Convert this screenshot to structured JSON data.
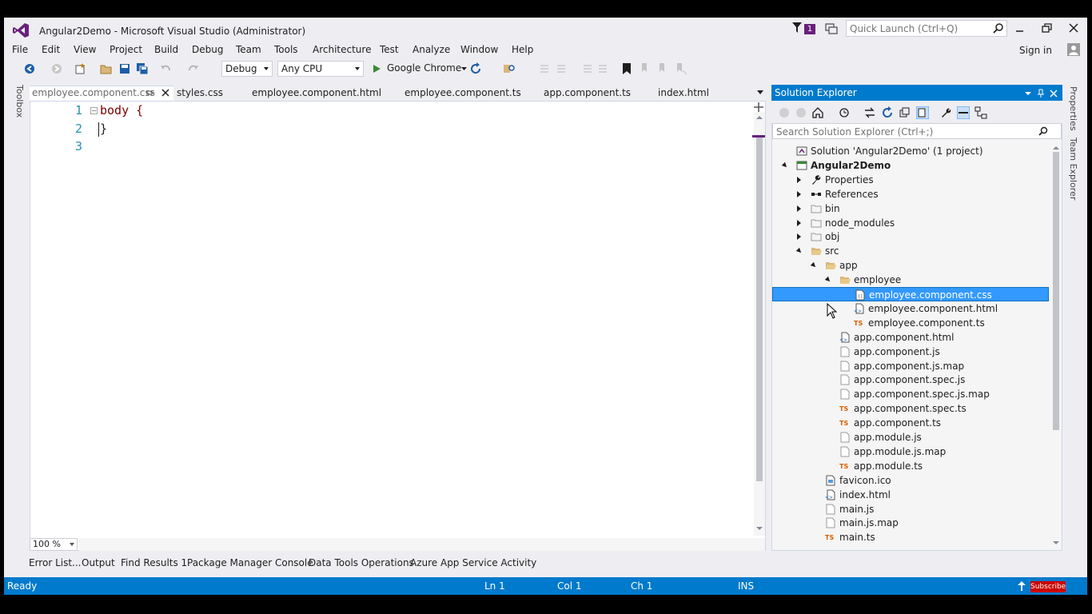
{
  "window": {
    "title": "Angular2Demo - Microsoft Visual Studio (Administrator)",
    "notification_count": "1",
    "quick_launch_placeholder": "Quick Launch (Ctrl+Q)",
    "sign_in": "Sign in"
  },
  "menu": [
    "File",
    "Edit",
    "View",
    "Project",
    "Build",
    "Debug",
    "Team",
    "Tools",
    "Architecture",
    "Test",
    "Analyze",
    "Window",
    "Help"
  ],
  "toolbar": {
    "configuration": "Debug",
    "platform": "Any CPU",
    "run_target": "Google Chrome"
  },
  "side_strips": {
    "left": "Toolbox",
    "right": [
      "Properties",
      "Team Explorer"
    ]
  },
  "document_tabs": [
    {
      "label": "employee.component.css",
      "active": true
    },
    {
      "label": "styles.css",
      "active": false
    },
    {
      "label": "employee.component.html",
      "active": false
    },
    {
      "label": "employee.component.ts",
      "active": false
    },
    {
      "label": "app.component.ts",
      "active": false
    },
    {
      "label": "index.html",
      "active": false
    }
  ],
  "editor": {
    "lines": [
      {
        "num": "1",
        "code": "body {"
      },
      {
        "num": "2",
        "code": "}"
      },
      {
        "num": "3",
        "code": ""
      }
    ],
    "zoom": "100 %"
  },
  "bottom_tabs": [
    "Error List...",
    "Output",
    "Find Results 1",
    "Package Manager Console",
    "Data Tools Operations",
    "Azure App Service Activity"
  ],
  "status": {
    "state": "Ready",
    "line": "Ln 1",
    "col": "Col 1",
    "ch": "Ch 1",
    "mode": "INS",
    "subscribe": "Subscribe"
  },
  "solution_explorer": {
    "title": "Solution Explorer",
    "search_placeholder": "Search Solution Explorer (Ctrl+;)",
    "items": [
      {
        "label": "Solution 'Angular2Demo' (1 project)",
        "level": 0,
        "expander": "none",
        "icon": "solution-icon"
      },
      {
        "label": "Angular2Demo",
        "level": 0,
        "expander": "expanded",
        "icon": "web-project-icon",
        "bold": true
      },
      {
        "label": "Properties",
        "level": 1,
        "expander": "collapsed",
        "icon": "wrench-icon"
      },
      {
        "label": "References",
        "level": 1,
        "expander": "collapsed",
        "icon": "references-icon"
      },
      {
        "label": "bin",
        "level": 1,
        "expander": "collapsed",
        "icon": "folder-outline-icon"
      },
      {
        "label": "node_modules",
        "level": 1,
        "expander": "collapsed",
        "icon": "folder-outline-icon"
      },
      {
        "label": "obj",
        "level": 1,
        "expander": "collapsed",
        "icon": "folder-outline-icon"
      },
      {
        "label": "src",
        "level": 1,
        "expander": "expanded",
        "icon": "folder-open-icon"
      },
      {
        "label": "app",
        "level": 2,
        "expander": "expanded",
        "icon": "folder-open-icon"
      },
      {
        "label": "employee",
        "level": 3,
        "expander": "expanded",
        "icon": "folder-open-icon"
      },
      {
        "label": "employee.component.css",
        "level": 4,
        "expander": "none",
        "icon": "css-file-icon",
        "selected": true
      },
      {
        "label": "employee.component.html",
        "level": 4,
        "expander": "none",
        "icon": "html-file-icon"
      },
      {
        "label": "employee.component.ts",
        "level": 4,
        "expander": "none",
        "icon": "ts-file-icon"
      },
      {
        "label": "app.component.html",
        "level": 3,
        "expander": "none",
        "icon": "html-file-icon"
      },
      {
        "label": "app.component.js",
        "level": 3,
        "expander": "none",
        "icon": "file-icon"
      },
      {
        "label": "app.component.js.map",
        "level": 3,
        "expander": "none",
        "icon": "file-icon"
      },
      {
        "label": "app.component.spec.js",
        "level": 3,
        "expander": "none",
        "icon": "file-icon"
      },
      {
        "label": "app.component.spec.js.map",
        "level": 3,
        "expander": "none",
        "icon": "file-icon"
      },
      {
        "label": "app.component.spec.ts",
        "level": 3,
        "expander": "none",
        "icon": "ts-file-icon"
      },
      {
        "label": "app.component.ts",
        "level": 3,
        "expander": "none",
        "icon": "ts-file-icon"
      },
      {
        "label": "app.module.js",
        "level": 3,
        "expander": "none",
        "icon": "file-icon"
      },
      {
        "label": "app.module.js.map",
        "level": 3,
        "expander": "none",
        "icon": "file-icon"
      },
      {
        "label": "app.module.ts",
        "level": 3,
        "expander": "none",
        "icon": "ts-file-icon"
      },
      {
        "label": "favicon.ico",
        "level": 2,
        "expander": "none",
        "icon": "image-file-icon"
      },
      {
        "label": "index.html",
        "level": 2,
        "expander": "none",
        "icon": "html-file-icon"
      },
      {
        "label": "main.js",
        "level": 2,
        "expander": "none",
        "icon": "file-icon"
      },
      {
        "label": "main.js.map",
        "level": 2,
        "expander": "none",
        "icon": "file-icon"
      },
      {
        "label": "main.ts",
        "level": 2,
        "expander": "none",
        "icon": "ts-file-icon"
      }
    ]
  },
  "colors": {
    "accent": "#007acc",
    "vs_purple": "#68217a",
    "selection": "#3399ff",
    "css_selector": "#800000",
    "line_number": "#2b91af",
    "ts_orange": "#d65f00"
  }
}
